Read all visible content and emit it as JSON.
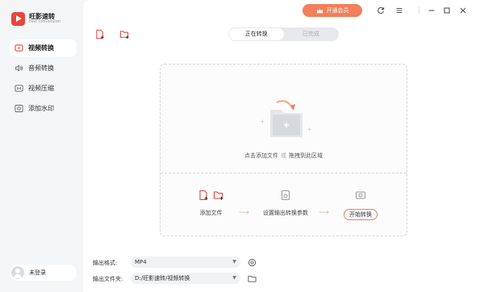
{
  "app": {
    "name": "旺影速转",
    "subtitle": "Fast conversion"
  },
  "sidebar": {
    "items": [
      {
        "label": "视频转换",
        "icon": "video-convert-icon",
        "active": true
      },
      {
        "label": "音频转换",
        "icon": "audio-icon",
        "active": false
      },
      {
        "label": "视频压缩",
        "icon": "compress-icon",
        "active": false
      },
      {
        "label": "添加水印",
        "icon": "watermark-icon",
        "active": false
      }
    ],
    "login_label": "未登录"
  },
  "header": {
    "vip_label": "开通会员",
    "tabs": [
      {
        "label": "正在转换",
        "active": true
      },
      {
        "label": "已完成",
        "active": false
      }
    ]
  },
  "drop_zone": {
    "hint_left": "点击添加文件",
    "hint_or": "或",
    "hint_right": "拖拽到此区域"
  },
  "steps": {
    "add_file": "添加文件",
    "set_params": "设置输出转换参数",
    "start": "开始转换"
  },
  "output": {
    "format_label": "输出格式:",
    "format_value": "MP4",
    "folder_label": "输出文件夹:",
    "folder_value": "D:/旺影速转/视频转换"
  },
  "colors": {
    "accent": "#f1805b",
    "brand": "#e8453c"
  }
}
